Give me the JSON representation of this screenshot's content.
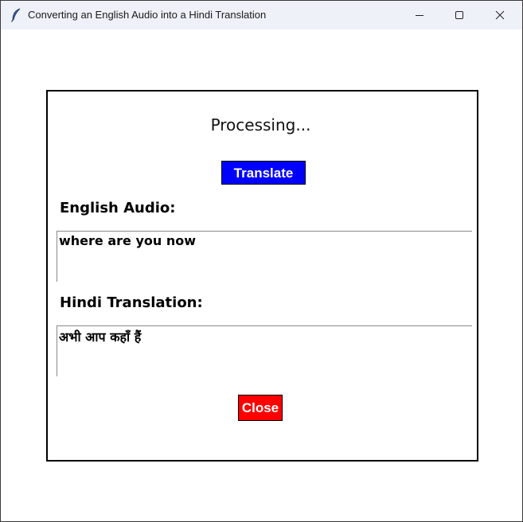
{
  "window": {
    "title": "Converting an English Audio into a Hindi Translation",
    "icon": "feather-icon",
    "controls": [
      "minimize-icon",
      "maximize-icon",
      "close-icon"
    ]
  },
  "main": {
    "status_text": "Processing...",
    "translate_label": "Translate",
    "english_label": "English Audio:",
    "english_text": "where are you now",
    "hindi_label": "Hindi Translation:",
    "hindi_text": "अभी आप कहाँ हैं",
    "close_label": "Close"
  },
  "colors": {
    "translate_button": "#0000ff",
    "close_button": "#ff0000",
    "titlebar": "#eef1f8"
  }
}
